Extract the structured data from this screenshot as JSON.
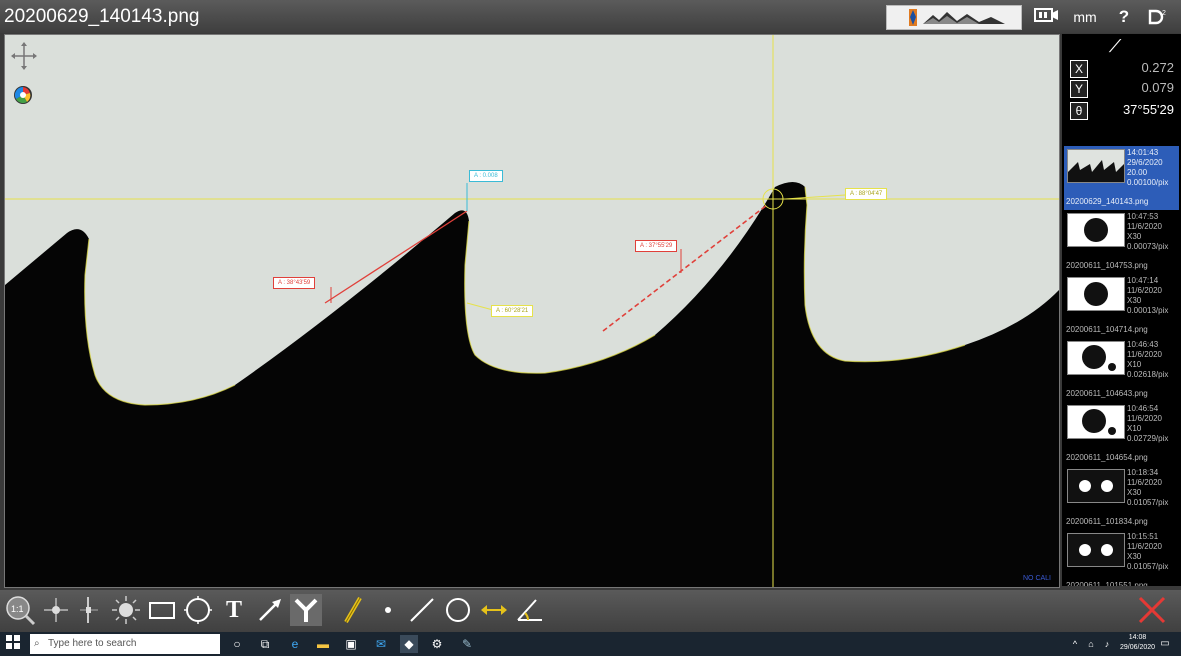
{
  "window": {
    "title": "20200629_140143.png",
    "unit": "mm",
    "help": "?",
    "colors": {
      "accent_selected": "#2d5db8",
      "measure_red": "#e0403a",
      "measure_yellow": "#e6e24a",
      "measure_cyan": "#3bbbd6"
    }
  },
  "coords": {
    "tool_glyph": "/",
    "x_key": "X",
    "x_value": "0.272",
    "y_key": "Y",
    "y_value": "0.079",
    "theta_key": "θ",
    "theta_value": "37°55'29"
  },
  "annotations": [
    {
      "id": "a1",
      "text": "A : 38°43'59"
    },
    {
      "id": "a2",
      "text": "A : 0.008"
    },
    {
      "id": "a3",
      "text": "A : 60°28'21"
    },
    {
      "id": "a4",
      "text": "A : 37°55'29"
    },
    {
      "id": "a5",
      "text": "A : 88°04'47"
    }
  ],
  "no_cali": "NO CALI",
  "thumbnails": [
    {
      "time": "14:01:43",
      "date": "29/6/2020",
      "zoom": "20.00",
      "scale": "0.00100/pix",
      "name": "20200629_140143.png",
      "selected": true,
      "kind": "teeth"
    },
    {
      "time": "10:47:53",
      "date": "11/6/2020",
      "zoom": "X30",
      "scale": "0.00073/pix",
      "name": "20200611_104753.png",
      "selected": false,
      "kind": "circle"
    },
    {
      "time": "10:47:14",
      "date": "11/6/2020",
      "zoom": "X30",
      "scale": "0.00013/pix",
      "name": "20200611_104714.png",
      "selected": false,
      "kind": "circle"
    },
    {
      "time": "10:46:43",
      "date": "11/6/2020",
      "zoom": "X10",
      "scale": "0.02618/pix",
      "name": "20200611_104643.png",
      "selected": false,
      "kind": "circle2"
    },
    {
      "time": "10:46:54",
      "date": "11/6/2020",
      "zoom": "X10",
      "scale": "0.02729/pix",
      "name": "20200611_104654.png",
      "selected": false,
      "kind": "circle2"
    },
    {
      "time": "10:18:34",
      "date": "11/6/2020",
      "zoom": "X30",
      "scale": "0.01057/pix",
      "name": "20200611_101834.png",
      "selected": false,
      "kind": "dots"
    },
    {
      "time": "10:15:51",
      "date": "11/6/2020",
      "zoom": "X30",
      "scale": "0.01057/pix",
      "name": "20200611_101551.png",
      "selected": false,
      "kind": "dots"
    }
  ],
  "toolbar": {
    "zoom_label": "1:1",
    "text_tool": "T"
  },
  "taskbar": {
    "search_placeholder": "Type here to search",
    "time": "14:08",
    "date": "29/06/2020"
  }
}
